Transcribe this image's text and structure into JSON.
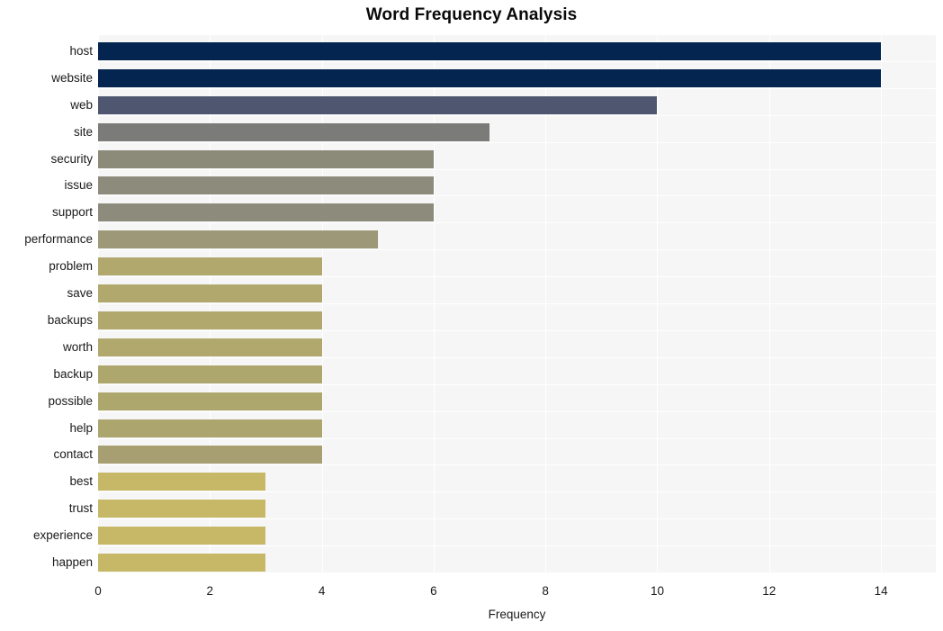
{
  "chart_data": {
    "type": "bar",
    "orientation": "horizontal",
    "title": "Word Frequency Analysis",
    "xlabel": "Frequency",
    "ylabel": "",
    "categories": [
      "host",
      "website",
      "web",
      "site",
      "security",
      "issue",
      "support",
      "performance",
      "problem",
      "save",
      "backups",
      "worth",
      "backup",
      "possible",
      "help",
      "contact",
      "best",
      "trust",
      "experience",
      "happen"
    ],
    "values": [
      14,
      14,
      10,
      7,
      6,
      6,
      6,
      5,
      4,
      4,
      4,
      4,
      4,
      4,
      4,
      4,
      3,
      3,
      3,
      3
    ],
    "bar_colors": [
      "#04254f",
      "#04254f",
      "#4f5670",
      "#7b7b7a",
      "#8c8a79",
      "#8d8b7b",
      "#8d8b7b",
      "#9d9877",
      "#b0a86d",
      "#b0a86d",
      "#b0a86d",
      "#b0a86d",
      "#aea76d",
      "#aea76d",
      "#aca56e",
      "#a79f71",
      "#c6b866",
      "#c6b866",
      "#c6b866",
      "#c6b866"
    ],
    "xlim": [
      0,
      14.98
    ],
    "xticks": [
      0,
      2,
      4,
      6,
      8,
      10,
      12,
      14
    ],
    "xtick_labels": [
      "0",
      "2",
      "4",
      "6",
      "8",
      "10",
      "12",
      "14"
    ],
    "grid": true,
    "grid_color": "#ffffff",
    "plot_background": "#f6f6f7",
    "figure_background": "#ffffff",
    "legend": null
  }
}
